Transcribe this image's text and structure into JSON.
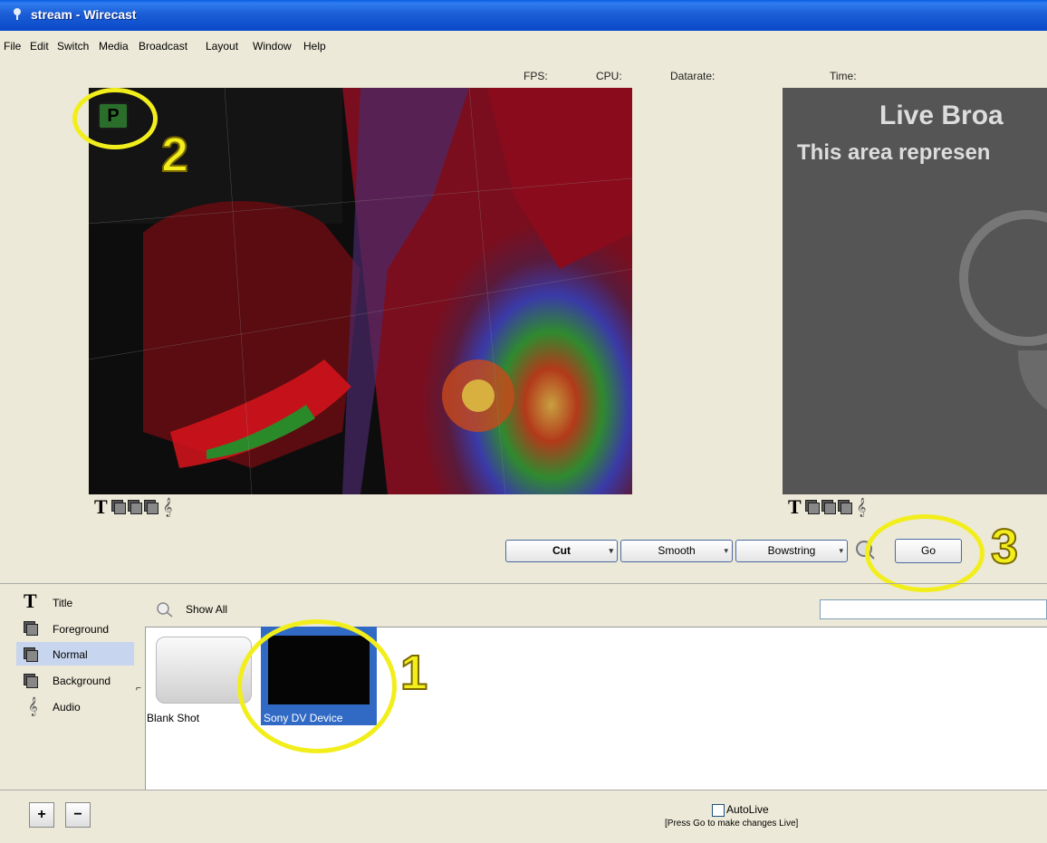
{
  "window": {
    "title": "stream - Wirecast"
  },
  "menu": [
    "File",
    "Edit",
    "Switch",
    "Media",
    "Broadcast",
    "Layout",
    "Window",
    "Help"
  ],
  "stats": {
    "fps": "FPS:",
    "cpu": "CPU:",
    "datarate": "Datarate:",
    "time": "Time:"
  },
  "live": {
    "line1": "Live Broa",
    "line2": "This area represen"
  },
  "transitions": {
    "cut": "Cut",
    "smooth": "Smooth",
    "bowstring": "Bowstring",
    "go": "Go"
  },
  "layers": [
    "Title",
    "Foreground",
    "Normal",
    "Background",
    "Audio"
  ],
  "selected_layer": "Normal",
  "shots_header": {
    "show_all": "Show All"
  },
  "shots": [
    {
      "name": "Blank Shot"
    },
    {
      "name": "Sony DV Device"
    }
  ],
  "autolive": {
    "label": "AutoLive",
    "hint": "[Press Go to make changes Live]"
  },
  "buttons": {
    "add": "+",
    "remove": "−"
  },
  "annotations": {
    "one": "1",
    "two": "2",
    "three": "3",
    "p_badge": "P"
  },
  "colors": {
    "titlebar": "#0a5ee4",
    "highlight": "#f2ee1c",
    "selection": "#316ac5"
  }
}
